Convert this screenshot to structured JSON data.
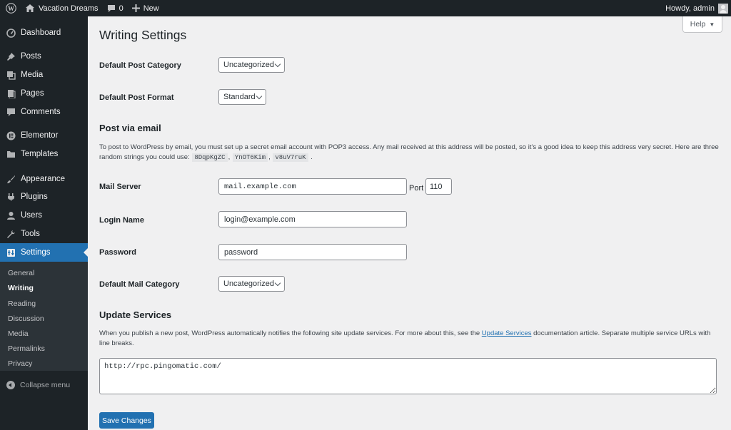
{
  "adminbar": {
    "site_name": "Vacation Dreams",
    "comments_count": "0",
    "new_label": "New",
    "howdy": "Howdy, admin"
  },
  "sidebar": {
    "items": [
      {
        "label": "Dashboard",
        "icon": "dashboard-icon"
      },
      {
        "label": "Posts",
        "icon": "pin-icon"
      },
      {
        "label": "Media",
        "icon": "media-icon"
      },
      {
        "label": "Pages",
        "icon": "pages-icon"
      },
      {
        "label": "Comments",
        "icon": "comment-icon"
      },
      {
        "label": "Elementor",
        "icon": "elementor-icon"
      },
      {
        "label": "Templates",
        "icon": "folder-icon"
      },
      {
        "label": "Appearance",
        "icon": "brush-icon"
      },
      {
        "label": "Plugins",
        "icon": "plugin-icon"
      },
      {
        "label": "Users",
        "icon": "user-icon"
      },
      {
        "label": "Tools",
        "icon": "wrench-icon"
      },
      {
        "label": "Settings",
        "icon": "settings-icon"
      }
    ],
    "submenu": [
      "General",
      "Writing",
      "Reading",
      "Discussion",
      "Media",
      "Permalinks",
      "Privacy"
    ],
    "collapse_label": "Collapse menu"
  },
  "help": {
    "label": "Help"
  },
  "page": {
    "title": "Writing Settings",
    "default_post_category": {
      "label": "Default Post Category",
      "value": "Uncategorized"
    },
    "default_post_format": {
      "label": "Default Post Format",
      "value": "Standard"
    },
    "post_via_email": {
      "title": "Post via email",
      "desc_1": "To post to WordPress by email, you must set up a secret email account with POP3 access. Any mail received at this address will be posted, so it’s a good idea to keep this address very secret. Here are three random strings you could use:",
      "codes": [
        "8DqpKgZC",
        "YnOT6Kim",
        "v8uV7ruK"
      ],
      "sep": ",",
      "end": "."
    },
    "mail_server": {
      "label": "Mail Server",
      "value": "mail.example.com",
      "port_label": "Port",
      "port_value": "110"
    },
    "login_name": {
      "label": "Login Name",
      "value": "login@example.com"
    },
    "password": {
      "label": "Password",
      "value": "password"
    },
    "default_mail_category": {
      "label": "Default Mail Category",
      "value": "Uncategorized"
    },
    "update_services": {
      "title": "Update Services",
      "desc_1": "When you publish a new post, WordPress automatically notifies the following site update services. For more about this, see the",
      "link": "Update Services",
      "desc_2": "documentation article. Separate multiple service URLs with line breaks.",
      "value": "http://rpc.pingomatic.com/"
    },
    "save_label": "Save Changes"
  },
  "colors": {
    "accent": "#2271b1",
    "sidebar_bg": "#1d2327",
    "submenu_bg": "#2c3338"
  }
}
